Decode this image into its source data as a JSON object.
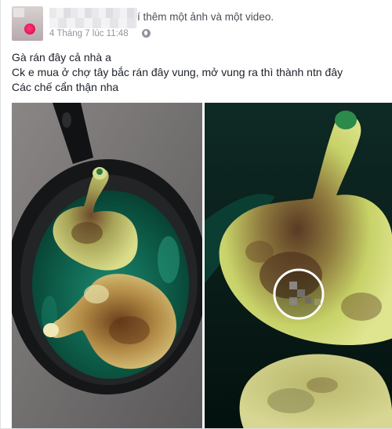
{
  "post": {
    "author_name": "",
    "action_text": "í thêm một ảnh và một video.",
    "timestamp": "4 Tháng 7 lúc 11:48",
    "privacy_icon": "globe-icon",
    "lines": [
      "Gà rán đây cả nhà a",
      "Ck e mua ở chợ tây bắc rán đây vung, mở vung ra thì thành ntn đây",
      "Các chế cẩn thận nha"
    ]
  },
  "media": {
    "photo": "fried-chicken-legs-in-pan",
    "video": "fried-chicken-close-up",
    "play_icon": "play-icon"
  },
  "colors": {
    "text": "#1d2129",
    "meta": "#90949c",
    "action": "#4b4f56",
    "oil_green": "#0f6e5a",
    "chicken_green": "#c9d36a"
  }
}
